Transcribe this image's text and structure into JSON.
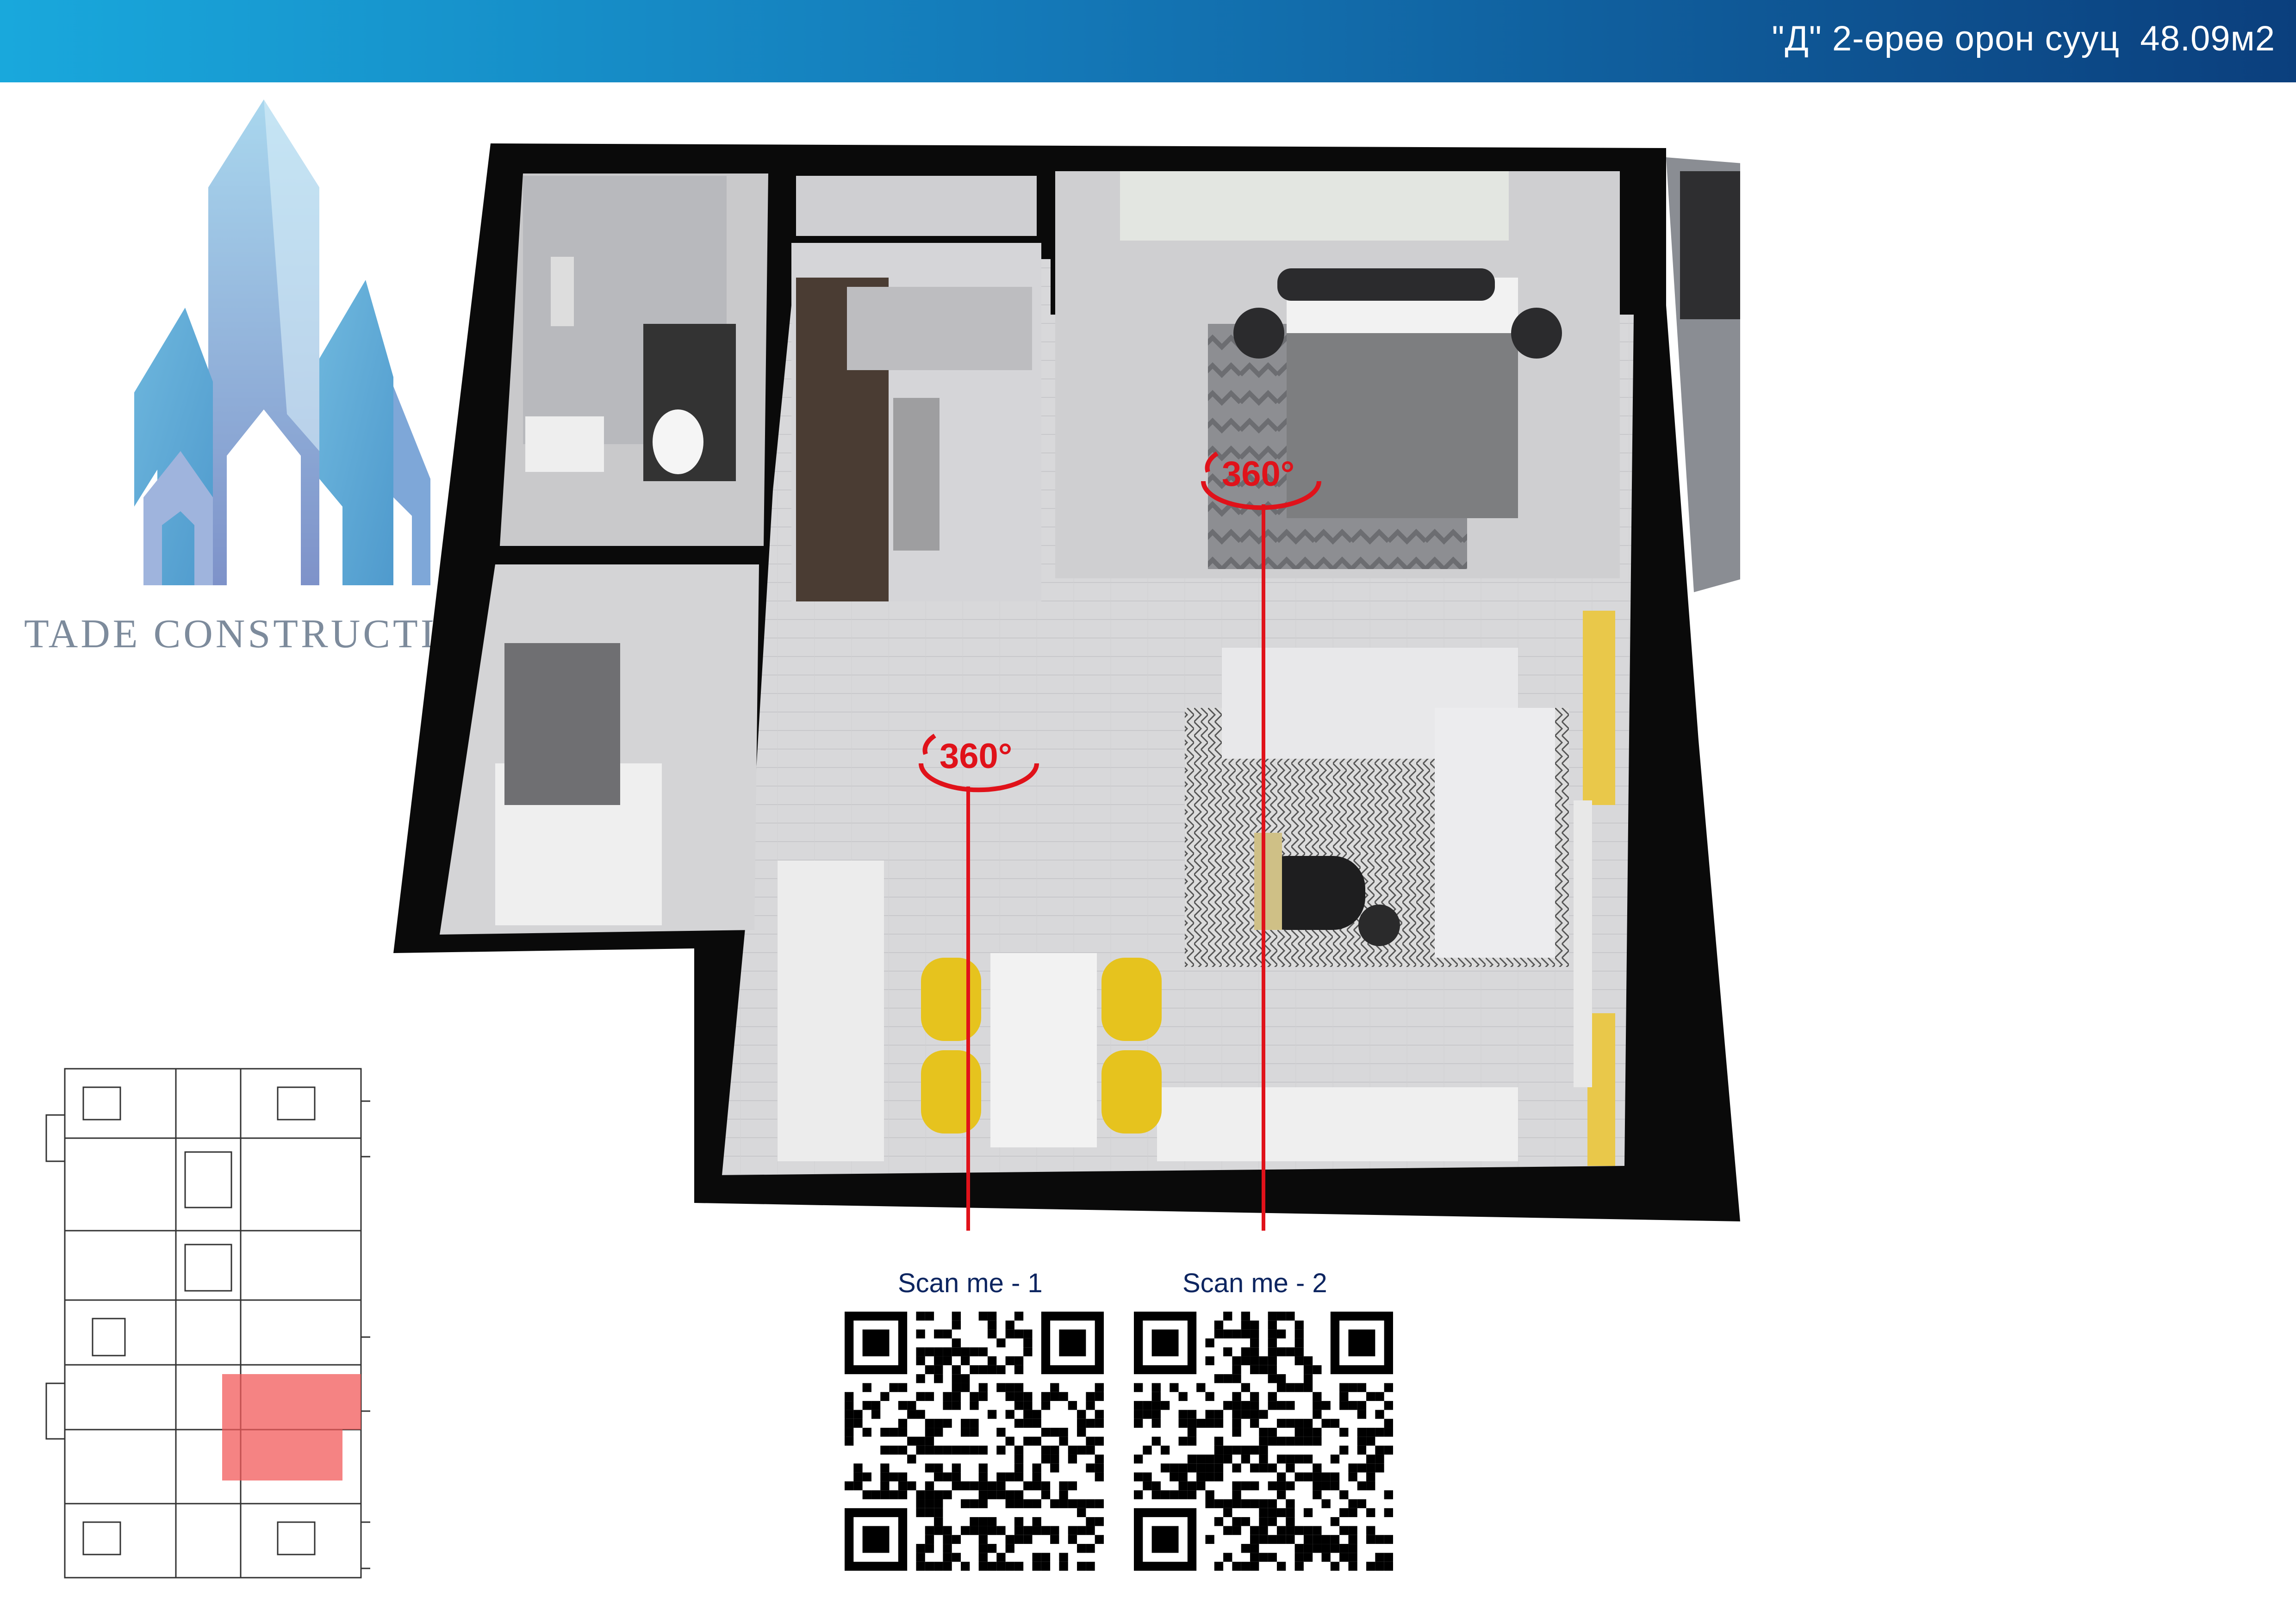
{
  "header": {
    "title": "\"Д\" 2-өрөө орон сууц  48.09м2"
  },
  "brand": {
    "company_name": "TADE CONSTRUCTION",
    "logo_icon": "skyscraper-logo"
  },
  "panorama_markers": [
    {
      "label": "360°",
      "scan_label": "Scan me - 1"
    },
    {
      "label": "360°",
      "scan_label": "Scan me - 2"
    }
  ],
  "colors": {
    "header_start": "#19a8dc",
    "header_end": "#0b3f7d",
    "marker_red": "#e0121a",
    "scan_text": "#0d2560",
    "highlight_unit": "#f25a5a",
    "chair_yellow": "#e6c31e"
  }
}
